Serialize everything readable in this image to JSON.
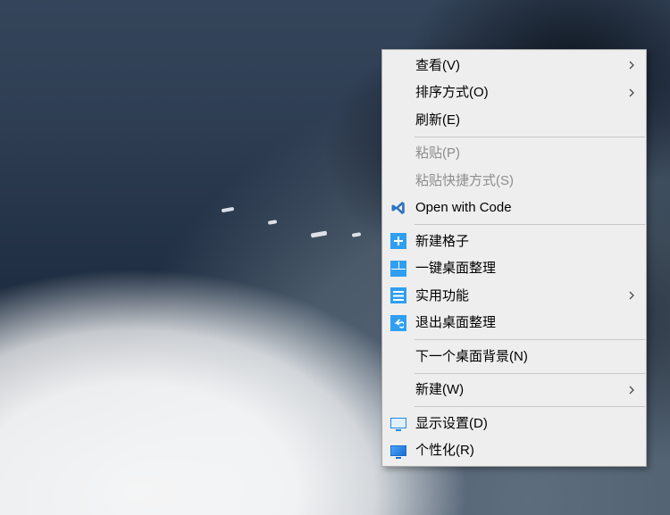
{
  "menu": {
    "view": {
      "label": "查看(V)",
      "has_submenu": true,
      "enabled": true
    },
    "sort": {
      "label": "排序方式(O)",
      "has_submenu": true,
      "enabled": true
    },
    "refresh": {
      "label": "刷新(E)",
      "has_submenu": false,
      "enabled": true
    },
    "paste": {
      "label": "粘贴(P)",
      "has_submenu": false,
      "enabled": false
    },
    "paste_shortcut": {
      "label": "粘贴快捷方式(S)",
      "has_submenu": false,
      "enabled": false
    },
    "open_with_code": {
      "label": "Open with Code",
      "has_submenu": false,
      "enabled": true
    },
    "new_grid": {
      "label": "新建格子",
      "has_submenu": false,
      "enabled": true
    },
    "organize_desktop": {
      "label": "一键桌面整理",
      "has_submenu": false,
      "enabled": true
    },
    "utilities": {
      "label": "实用功能",
      "has_submenu": true,
      "enabled": true
    },
    "exit_organize": {
      "label": "退出桌面整理",
      "has_submenu": false,
      "enabled": true
    },
    "next_wallpaper": {
      "label": "下一个桌面背景(N)",
      "has_submenu": false,
      "enabled": true
    },
    "new": {
      "label": "新建(W)",
      "has_submenu": true,
      "enabled": true
    },
    "display_settings": {
      "label": "显示设置(D)",
      "has_submenu": false,
      "enabled": true
    },
    "personalize": {
      "label": "个性化(R)",
      "has_submenu": false,
      "enabled": true
    }
  },
  "colors": {
    "icon_blue": "#2f9ff2"
  }
}
